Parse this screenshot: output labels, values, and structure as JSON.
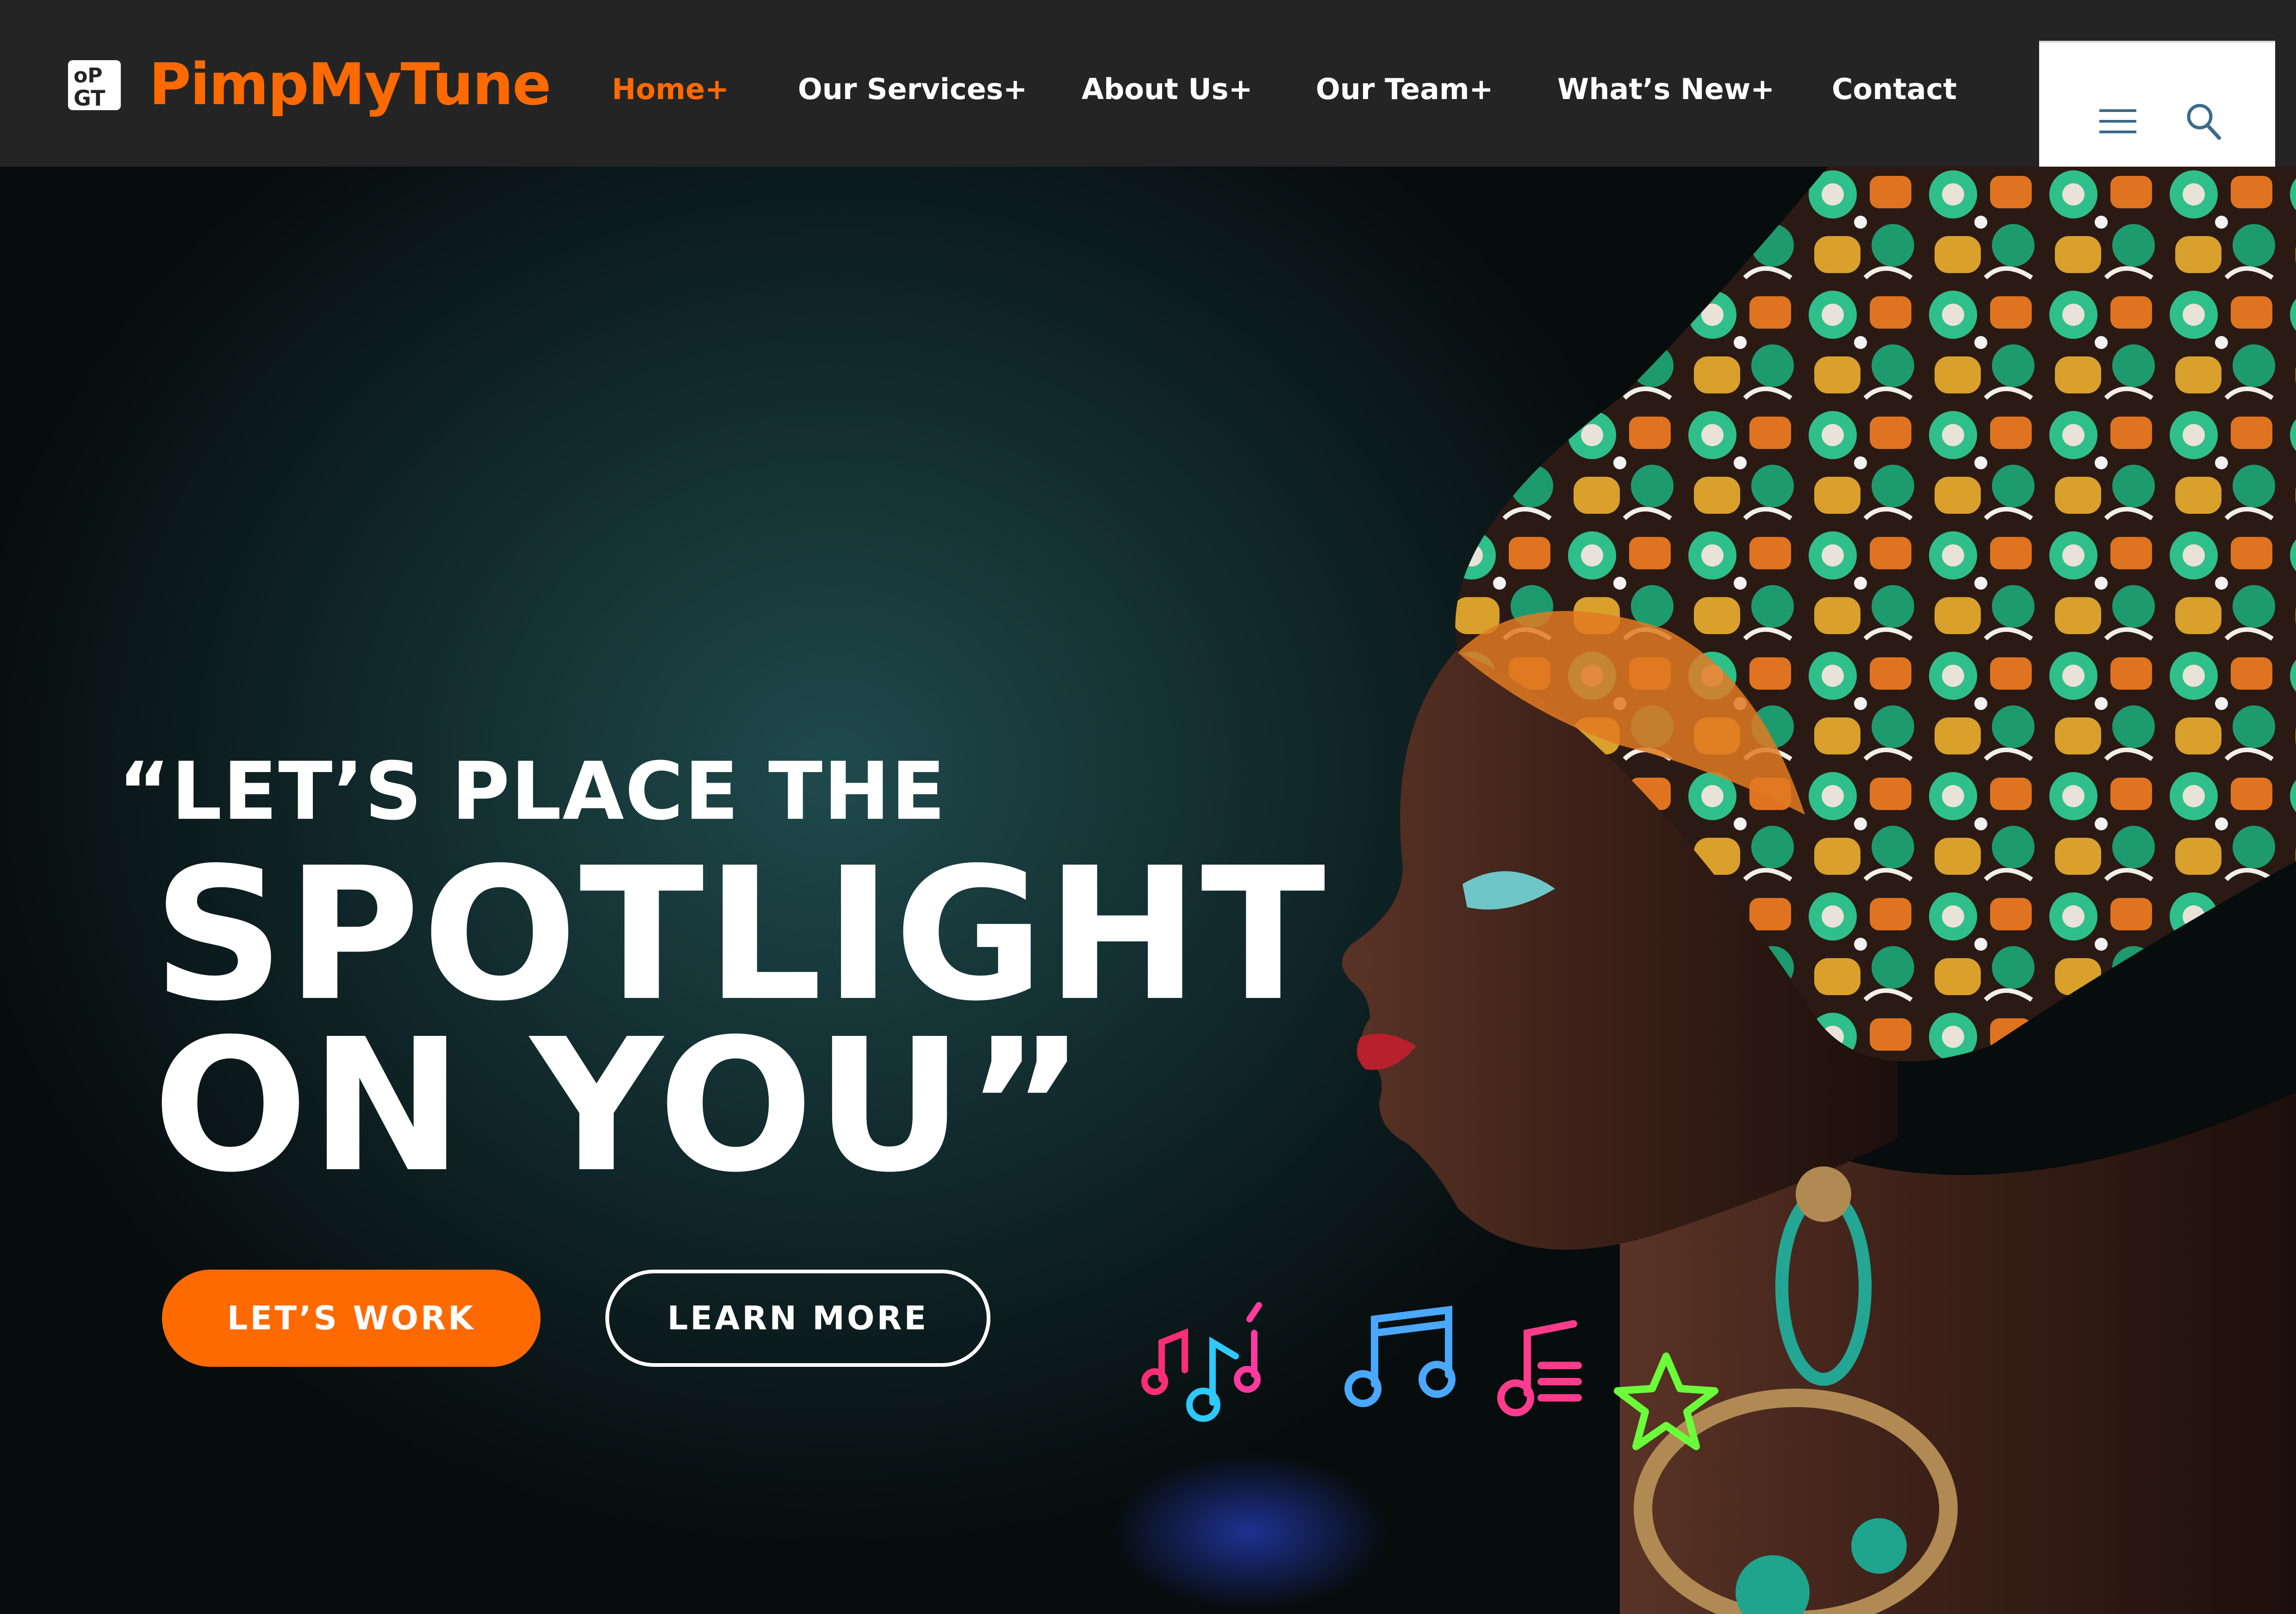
{
  "brand": {
    "name": "PimpMyTune",
    "logo_icon": "pmt-logo-icon",
    "accent_color": "#ff6a00"
  },
  "nav": {
    "items": [
      {
        "label": "Home+",
        "active": true
      },
      {
        "label": "Our Services+",
        "active": false
      },
      {
        "label": "About Us+",
        "active": false
      },
      {
        "label": "Our Team+",
        "active": false
      },
      {
        "label": "What’s New+",
        "active": false
      },
      {
        "label": "Contact",
        "active": false
      }
    ],
    "menu_icon": "hamburger-menu-icon",
    "search_icon": "search-icon"
  },
  "hero": {
    "line1": "“LET’S PLACE THE",
    "line2": "SPOTLIGHT",
    "line3": "ON YOU”",
    "primary_button": "LET’S WORK",
    "secondary_button": "LEARN MORE",
    "image": "woman-in-headwrap-profile-photo",
    "decor_icons": [
      "music-notes-neon-icon",
      "eighth-notes-neon-icon",
      "music-note-neon-icon",
      "star-neon-icon"
    ]
  },
  "colors": {
    "navbar_bg": "#242424",
    "accent": "#ff6a00",
    "hero_bg": "#173739",
    "text": "#ffffff"
  }
}
